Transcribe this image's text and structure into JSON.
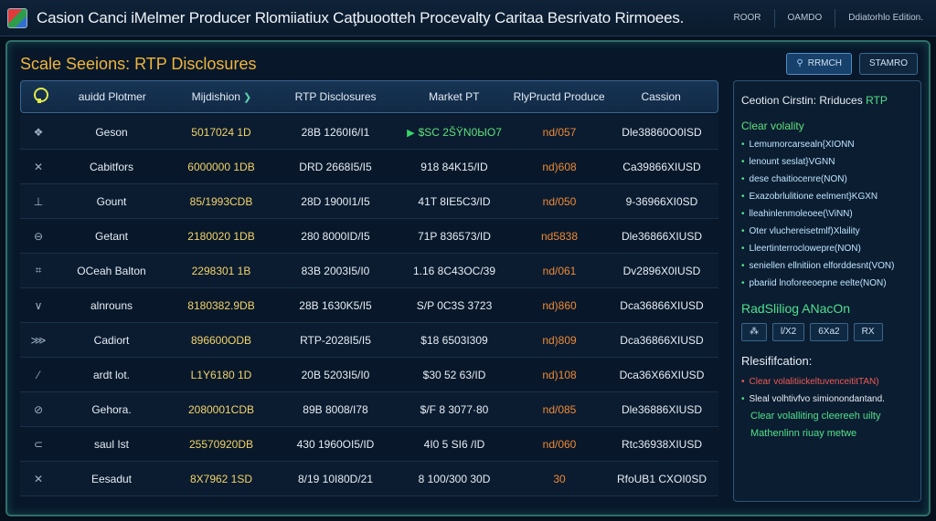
{
  "window": {
    "title": "Casion Canci iMelmer Producer Rlomiiatiux Caţbuootteh Procevalty Caritaa Besrivato Rirmoees.",
    "actions": [
      "ROOR",
      "OAMDO",
      "Ddiatorhlo Edition."
    ]
  },
  "section": {
    "title": "Scale Seeions: RTP Disclosures",
    "buttons": {
      "primary": "RRMCH",
      "secondary": "STAMRO"
    }
  },
  "table": {
    "headers": [
      "auidd Plotmer",
      "Mijdishion",
      "RTP Disclosures",
      "Market PT",
      "RlyPructd Producer",
      "Cassion"
    ],
    "rows": [
      {
        "icon": "❖",
        "name": "Geson",
        "id": "5017024 1D",
        "disc": "28B 1260I6/I1",
        "market": "$SC 2ŠŸN0ЫO7",
        "rtp": "nd/057",
        "cassion": "Dle38860O0ISD"
      },
      {
        "icon": "✕",
        "name": "Cabitfors",
        "id": "6000000 1DB",
        "disc": "DRD 2668I5/I5",
        "market": "918 84K15/ID",
        "rtp": "nd)608",
        "cassion": "Ca39866XIUSD"
      },
      {
        "icon": "⊥",
        "name": "Gount",
        "id": "85/1993CDB",
        "disc": "28D 1900I1/I5",
        "market": "41T 8IE5C3/ID",
        "rtp": "nd/050",
        "cassion": "9-36966XI0SD"
      },
      {
        "icon": "⊖",
        "name": "Getant",
        "id": "2180020 1DB",
        "disc": "280 8000ID/I5",
        "market": "71P 836573/ID",
        "rtp": "nd5838",
        "cassion": "Dle36866XIUSD"
      },
      {
        "icon": "⌗",
        "name": "OCeah Balton",
        "id": "2298301 1B",
        "disc": "83B 2003I5/I0",
        "market": "1.16 8C43OC/39",
        "rtp": "nd/061",
        "cassion": "Dv2896X0IUSD"
      },
      {
        "icon": "∨",
        "name": "alnrouns",
        "id": "8180382.9DB",
        "disc": "28B 1630K5/I5",
        "market": "S/P 0C3S 3723",
        "rtp": "nd)860",
        "cassion": "Dca36866XIUSD"
      },
      {
        "icon": "⋙",
        "name": "Cadiort",
        "id": "896600ODB",
        "disc": "RTP-2028I5/I5",
        "market": "$18 6503I309",
        "rtp": "nd)809",
        "cassion": "Dca36866XIUSD"
      },
      {
        "icon": "⁄",
        "name": "ardt lot.",
        "id": "L1Y6180 1D",
        "disc": "20B 5203I5/I0",
        "market": "$30 52 63/ID",
        "rtp": "nd)108",
        "cassion": "Dca36X66XIUSD"
      },
      {
        "icon": "⊘",
        "name": "Gehora.",
        "id": "2080001CDB",
        "disc": "89B 8008/I78",
        "market": "$/F 8 3077·80",
        "rtp": "nd/085",
        "cassion": "Dle36886XIUSD"
      },
      {
        "icon": "⊂",
        "name": "saul Ist",
        "id": "25570920DB",
        "disc": "430 1960OI5/ID",
        "market": "4I0 5 SI6 /ID",
        "rtp": "nd/060",
        "cassion": "Rtc36938XIUSD"
      },
      {
        "icon": "✕",
        "name": "Eesadut",
        "id": "8X7962 1SD",
        "disc": "8/19 10I80D/21",
        "market": "8 100/300 30D",
        "rtp": "30",
        "cassion": "RfoUB1 CXOI0SD"
      }
    ]
  },
  "side": {
    "head_prefix": "Ceotion Cirstin: Rriduces",
    "head_accent": "RTP",
    "sub": "Clear volality",
    "bullets": [
      "Lemumorcarsealn{XIONN",
      "lenount seslat}VGNN",
      "dese chaitiocenre(NON)",
      "Exazobrlulitione eelment}KGXN",
      "lleahinlenmoleoee(\\ViNN)",
      "Oter vluchereisetmlf)Xlaility",
      "Lleertinterroclowepre(NON)",
      "seniellen ellnitiion elforddesnt(VON)",
      "pbariid lnoforeeoepne eelte(NON)"
    ],
    "section": "RadSliliog ANacOn",
    "chips": [
      "⁂",
      "l/X2",
      "6Xa2",
      "RX"
    ],
    "title2": "Rlesififcation:",
    "note_red": "Clear volalitiickeltuvenceititTAN)",
    "note_white": "Sleal volhtivfvo simionondantand.",
    "note_green1": "Clear volalliting cleereeh uilty",
    "note_green2": "Mathenlinn riuay metwe"
  }
}
